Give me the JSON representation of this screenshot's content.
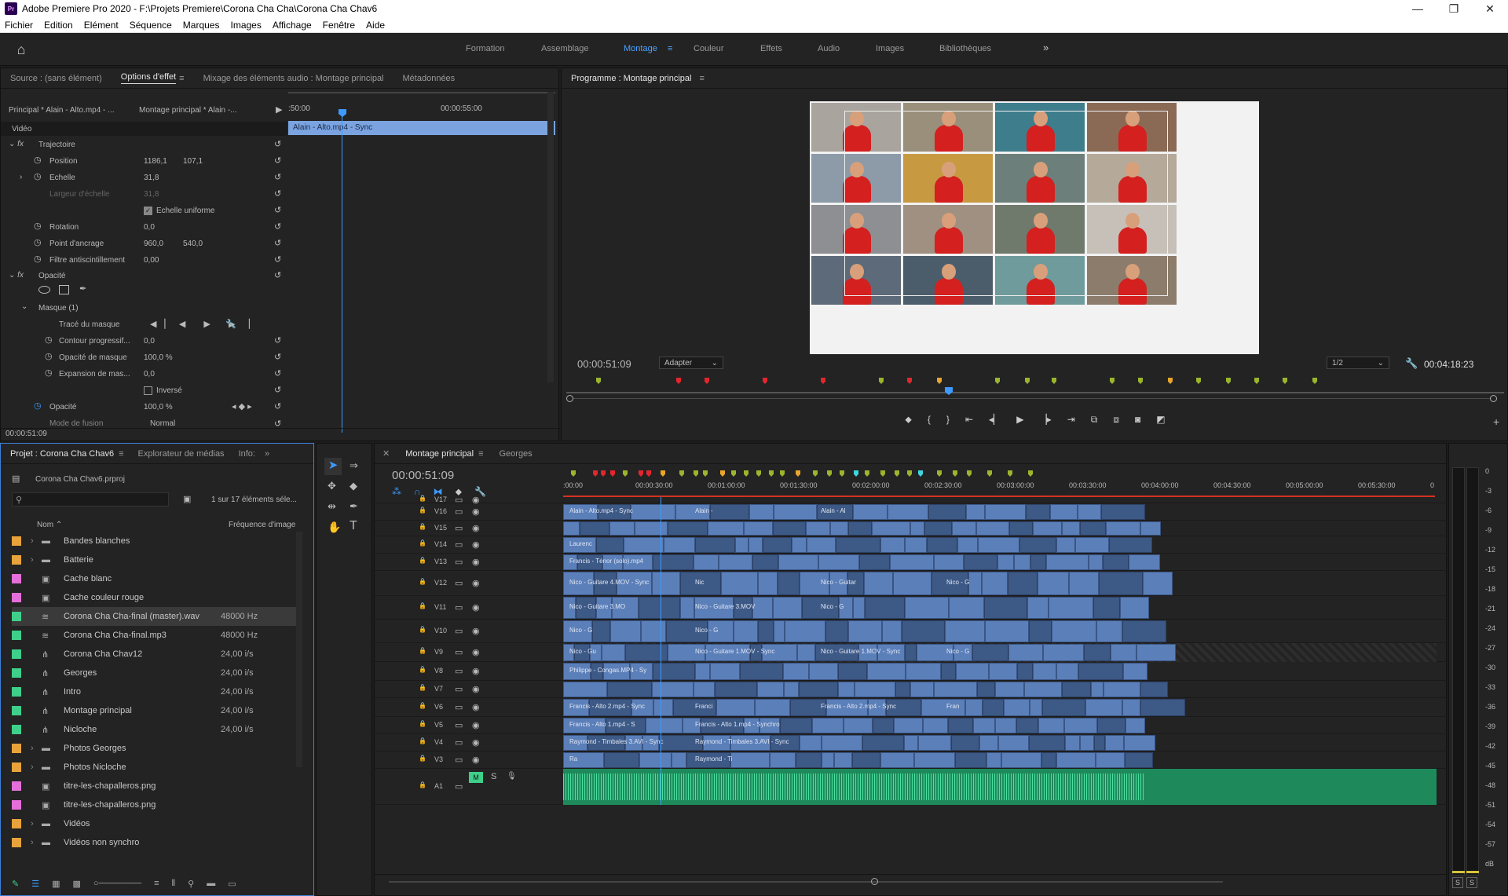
{
  "window": {
    "title": "Adobe Premiere Pro 2020 - F:\\Projets Premiere\\Corona Cha Cha\\Corona Cha Chav6",
    "app_badge": "Pr"
  },
  "menu": [
    "Fichier",
    "Edition",
    "Elément",
    "Séquence",
    "Marques",
    "Images",
    "Affichage",
    "Fenêtre",
    "Aide"
  ],
  "workspaces": [
    "Formation",
    "Assemblage",
    "Montage",
    "Couleur",
    "Effets",
    "Audio",
    "Images",
    "Bibliothèques"
  ],
  "active_workspace": "Montage",
  "effects_panel": {
    "tabs": [
      "Source : (sans élément)",
      "Options d'effet",
      "Mixage des éléments audio : Montage principal",
      "Métadonnées"
    ],
    "clip_master": "Principal * Alain - Alto.mp4 - ...",
    "clip_seq": "Montage principal * Alain -...",
    "time_a": ":50:00",
    "time_b": "00:00:55:00",
    "clip_bar": "Alain - Alto.mp4 - Sync",
    "section_video": "Vidéo",
    "trajectoire": "Trajectoire",
    "position_label": "Position",
    "position_x": "1186,1",
    "position_y": "107,1",
    "echelle_label": "Echelle",
    "echelle_val": "31,8",
    "largeur_label": "Largeur d'échelle",
    "largeur_val": "31,8",
    "uniforme_label": "Echelle uniforme",
    "rotation_label": "Rotation",
    "rotation_val": "0,0",
    "ancrage_label": "Point d'ancrage",
    "ancrage_x": "960,0",
    "ancrage_y": "540,0",
    "filtre_label": "Filtre antiscintillement",
    "filtre_val": "0,00",
    "opacite_section": "Opacité",
    "masque": "Masque (1)",
    "trace": "Tracé du masque",
    "contour_label": "Contour progressif...",
    "contour_val": "0,0",
    "opacite_masque_label": "Opacité de masque",
    "opacite_masque_val": "100,0 %",
    "expansion_label": "Expansion de mas...",
    "expansion_val": "0,0",
    "inverse_label": "Inversé",
    "opacite_label": "Opacité",
    "opacite_val": "100,0 %",
    "fusion_label": "Mode de fusion",
    "fusion_val": "Normal",
    "timecode": "00:00:51:09"
  },
  "program": {
    "tab": "Programme : Montage principal",
    "timecode": "00:00:51:09",
    "fit": "Adapter",
    "resolution": "1/2",
    "duration": "00:04:18:23"
  },
  "project": {
    "tabs": [
      "Projet : Corona Cha Chav6",
      "Explorateur de médias",
      "Info:"
    ],
    "file": "Corona Cha Chav6.prproj",
    "count": "1 sur 17 éléments séle...",
    "col_name": "Nom",
    "col_fps": "Fréquence d'image",
    "items": [
      {
        "name": "Bandes blanches",
        "fps": "",
        "color": "#e8a33a",
        "type": "folder"
      },
      {
        "name": "Batterie",
        "fps": "",
        "color": "#e8a33a",
        "type": "folder"
      },
      {
        "name": "Cache blanc",
        "fps": "",
        "color": "#e46fd8",
        "type": "item"
      },
      {
        "name": "Cache couleur rouge",
        "fps": "",
        "color": "#e46fd8",
        "type": "item"
      },
      {
        "name": "Corona Cha Cha-final (master).wav",
        "fps": "48000  Hz",
        "color": "#3ed08a",
        "type": "audio"
      },
      {
        "name": "Corona Cha Cha-final.mp3",
        "fps": "48000  Hz",
        "color": "#3ed08a",
        "type": "audio"
      },
      {
        "name": "Corona Cha Chav12",
        "fps": "24,00 i/s",
        "color": "#3ed08a",
        "type": "seq"
      },
      {
        "name": "Georges",
        "fps": "24,00 i/s",
        "color": "#3ed08a",
        "type": "seq"
      },
      {
        "name": "Intro",
        "fps": "24,00 i/s",
        "color": "#3ed08a",
        "type": "seq"
      },
      {
        "name": "Montage principal",
        "fps": "24,00 i/s",
        "color": "#3ed08a",
        "type": "seq"
      },
      {
        "name": "Nicloche",
        "fps": "24,00 i/s",
        "color": "#3ed08a",
        "type": "seq"
      },
      {
        "name": "Photos Georges",
        "fps": "",
        "color": "#e8a33a",
        "type": "folder"
      },
      {
        "name": "Photos Nicloche",
        "fps": "",
        "color": "#e8a33a",
        "type": "folder"
      },
      {
        "name": "titre-les-chapalleros.png",
        "fps": "",
        "color": "#e46fd8",
        "type": "item"
      },
      {
        "name": "titre-les-chapalleros.png",
        "fps": "",
        "color": "#e46fd8",
        "type": "item"
      },
      {
        "name": "Vidéos",
        "fps": "",
        "color": "#e8a33a",
        "type": "folder"
      },
      {
        "name": "Vidéos non synchro",
        "fps": "",
        "color": "#e8a33a",
        "type": "folder"
      }
    ]
  },
  "timeline": {
    "tabs": [
      "Montage principal",
      "Georges"
    ],
    "timecode": "00:00:51:09",
    "ruler": [
      ":00:00",
      "00:00:30:00",
      "00:01:00:00",
      "00:01:30:00",
      "00:02:00:00",
      "00:02:30:00",
      "00:03:00:00",
      "00:03:30:00",
      "00:04:00:00",
      "00:04:30:00",
      "00:05:00:00",
      "00:05:30:00",
      "0"
    ],
    "tracks": [
      "V17",
      "V16",
      "V15",
      "V14",
      "V13",
      "V12",
      "V11",
      "V10",
      "V9",
      "V8",
      "V7",
      "V6",
      "V5",
      "V4",
      "V3",
      "A1"
    ],
    "clip_labels": [
      "Alain - Alto.mp4 - Sync",
      "Alain -",
      "Alain - Al",
      "Laurenc",
      "Francis - Ténor (solo).mp4",
      "Nico - Guitare 4.MOV - Sync",
      "Nic",
      "Nico - Guitar",
      "Nico - G",
      "Nico - Guitare 3.MO",
      "Nico - Guitare 3.MOV",
      "Nico - G",
      "Nico - G",
      "Nico - G",
      "Nico - Gu",
      "Nico - Guitare 1.MOV - Sync",
      "Nico - Guitare 1.MOV - Sync",
      "Nico - G",
      "Philippe - Congas.MP4 - Sy",
      "Francis - Alto 2.mp4 - Sync",
      "Franci",
      "Francis - Alto 2.mp4 - Sync",
      "Fran",
      "Francis - Alto 1.mp4 - S",
      "Francis - Alto 1.mp4 - Synchro",
      "Raymond - Timbales 3.AVI - Sync",
      "Raymond - Timbales 3.AVI - Sync",
      "Ra",
      "Raymond - Ti"
    ],
    "a1_m": "M",
    "a1_s": "S"
  },
  "meter": {
    "scale": [
      "0",
      "-3",
      "-6",
      "-9",
      "-12",
      "-15",
      "-18",
      "-21",
      "-24",
      "-27",
      "-30",
      "-33",
      "-36",
      "-39",
      "-42",
      "-45",
      "-48",
      "-51",
      "-54",
      "-57",
      "dB"
    ],
    "solo": "S"
  }
}
